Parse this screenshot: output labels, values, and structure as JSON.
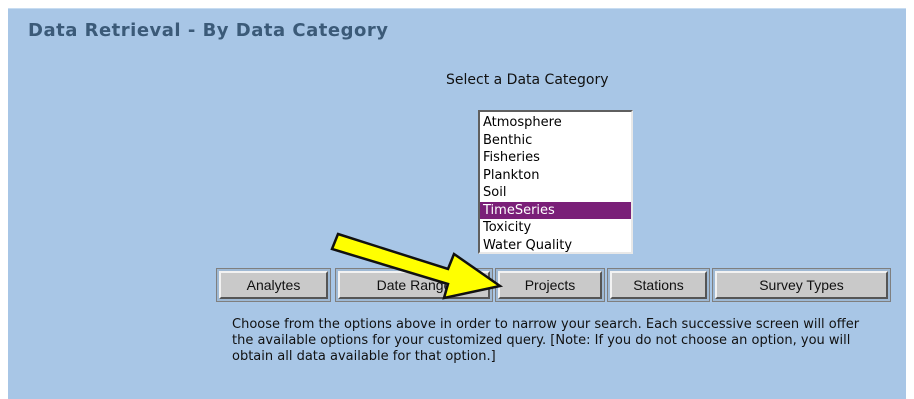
{
  "header": {
    "title": "Data Retrieval - By Data Category"
  },
  "selector": {
    "prompt": "Select a Data Category",
    "options": [
      "Atmosphere",
      "Benthic",
      "Fisheries",
      "Plankton",
      "Soil",
      "TimeSeries",
      "Toxicity",
      "Water Quality"
    ],
    "selected": "TimeSeries",
    "selected_color": "#7a1f78"
  },
  "buttons": {
    "analytes": "Analytes",
    "date_range": "Date Range",
    "projects": "Projects",
    "stations": "Stations",
    "survey_types": "Survey Types"
  },
  "help": {
    "text": "Choose from the options above in order to narrow your search. Each successive screen will offer the available options for your customized query.  [Note: If you do not choose an option, you will obtain all data available for that option.]"
  },
  "annotation": {
    "icon": "arrow-icon",
    "color": "#ffff00"
  },
  "colors": {
    "panel_bg": "#a8c6e6",
    "title": "#3b5a78"
  }
}
